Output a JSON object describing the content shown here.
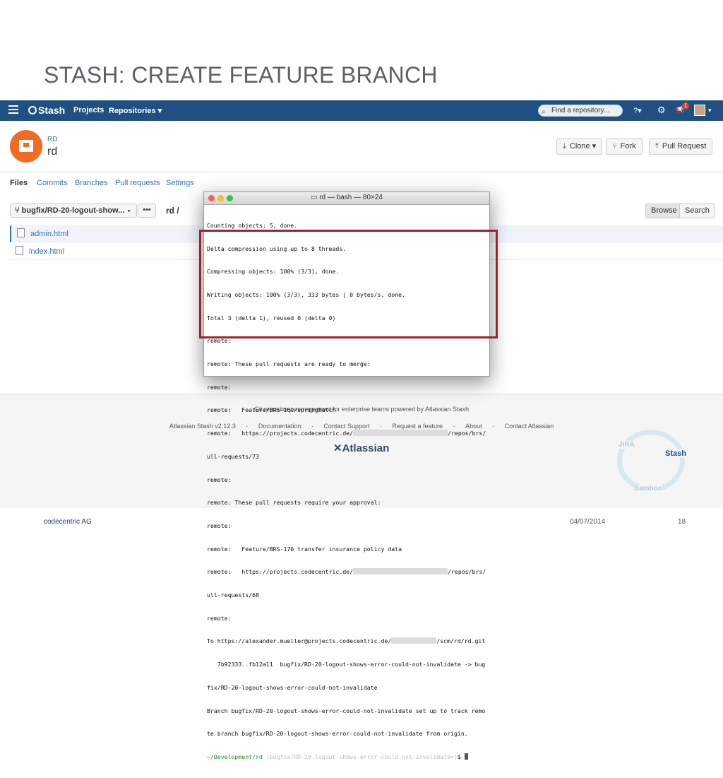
{
  "slide": {
    "title": "STASH: CREATE FEATURE BRANCH",
    "footer_company": "codecentric AG",
    "footer_date": "04/07/2014",
    "page_number": "18"
  },
  "navbar": {
    "logo": "Stash",
    "projects": "Projects",
    "repositories": "Repositories ▾",
    "search_placeholder": "Find a repository...",
    "help_icon": "?▾",
    "settings_icon": "⚙",
    "notif_icon": "📢",
    "notif_count": "1",
    "avatar_caret": "▾",
    "icons": [
      "menu-icon",
      "stash-logo-icon",
      "search-icon",
      "help-icon",
      "gear-icon",
      "megaphone-icon",
      "avatar"
    ]
  },
  "repo": {
    "project_key": "RD",
    "name": "rd"
  },
  "actions": {
    "clone": "Clone ▾",
    "fork": "Fork",
    "pull_request": "Pull Request"
  },
  "tabs": [
    "Files",
    "Commits",
    "Branches",
    "Pull requests",
    "Settings"
  ],
  "browser": {
    "branch": "bugfix/RD-20-logout-show... ▾",
    "more": "•••",
    "path": "rd /",
    "browse": "Browse",
    "search": "Search",
    "files": [
      "admin.html",
      "index.html"
    ]
  },
  "footer": {
    "tagline": "Git repository management for enterprise teams powered by Atlassian Stash",
    "links": [
      "Atlassian Stash v2.12.3",
      "·",
      "Documentation",
      "·",
      "Contact Support",
      "·",
      "Request a feature",
      "·",
      "About",
      "·",
      "Contact Atlassian"
    ],
    "atlassian": "Atlassian",
    "cycle_jira": "JIRA",
    "cycle_stash": "Stash",
    "cycle_bamboo": "Bamboo"
  },
  "terminal": {
    "title": "rd — bash — 80×24",
    "lines": [
      "Counting objects: 5, done.",
      "Delta compression using up to 8 threads.",
      "Compressing objects: 100% (3/3), done.",
      "Writing objects: 100% (3/3), 333 bytes | 0 bytes/s, done.",
      "Total 3 (delta 1), reused 0 (delta 0)",
      "remote:",
      "remote: These pull requests are ready to merge:",
      "remote:",
      "remote:   Feature/BRS-169/springBatch",
      "remote:   https://projects.codecentric.de/",
      "ull-requests/73",
      "remote:",
      "remote: These pull requests require your approval:",
      "remote:",
      "remote:   Feature/BRS-170 transfer insurance policy data",
      "remote:   https://projects.codecentric.de/",
      "ull-requests/68",
      "remote:",
      "To https://alexander.mueller@projects.codecentric.de/",
      "   7b92333..fb12a11  bugfix/RD-20-logout-shows-error-could-not-invalidate -> bug",
      "fix/RD-20-logout-shows-error-could-not-invalidate",
      "Branch bugfix/RD-20-logout-shows-error-could-not-invalidate set up to track remo",
      "te branch bugfix/RD-20-logout-shows-error-could-not-invalidate from origin."
    ],
    "url_suffix": "/repos/brs/p",
    "git_suffix": "/scm/rd/rd.git",
    "prompt_path": "~/Development/rd",
    "prompt_branch": " (bugfix/RD-20-logout-shows-error-could-not-invalidate=)",
    "prompt_symbol": "$ "
  }
}
